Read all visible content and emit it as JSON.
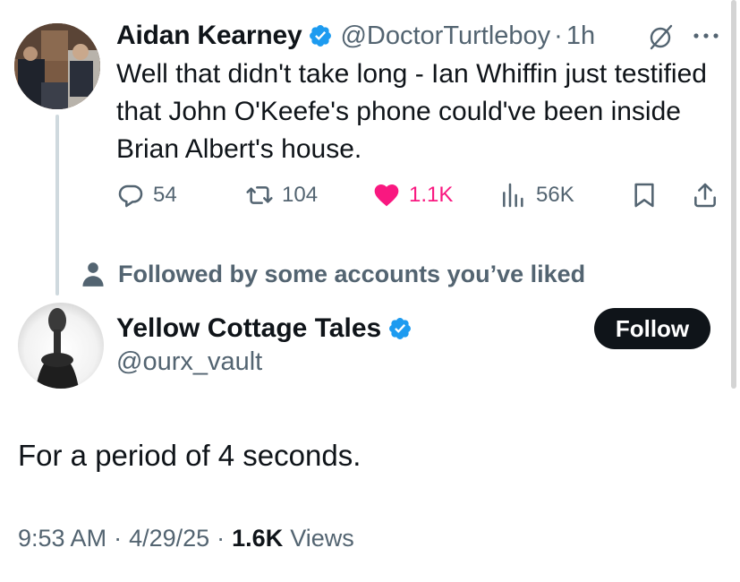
{
  "tweet": {
    "author_name": "Aidan Kearney",
    "author_handle": "@DoctorTurtleboy",
    "time_sep": "·",
    "time": "1h",
    "text": "Well that didn't take long - Ian Whiffin just testified that John O'Keefe's phone could've been inside Brian Albert's house.",
    "stats": {
      "replies": "54",
      "reposts": "104",
      "likes": "1.1K",
      "views": "56K"
    },
    "like_color": "#f91880"
  },
  "social_context": "Followed by some accounts you’ve liked",
  "reply": {
    "author_name": "Yellow Cottage Tales",
    "author_handle": "@ourx_vault",
    "follow_label": "Follow",
    "text": "For a period of 4 seconds.",
    "meta": {
      "time": "9:53 AM",
      "sep1": "·",
      "date": "4/29/25",
      "sep2": "·",
      "views_count": "1.6K",
      "views_label": "Views"
    }
  },
  "colors": {
    "verified": "#1d9bf0",
    "text_primary": "#0f1419",
    "text_secondary": "#536471"
  },
  "icons": [
    "verified-badge-icon",
    "grok-icon",
    "more-icon",
    "reply-icon",
    "repost-icon",
    "like-icon",
    "views-icon",
    "bookmark-icon",
    "share-icon",
    "person-icon"
  ]
}
